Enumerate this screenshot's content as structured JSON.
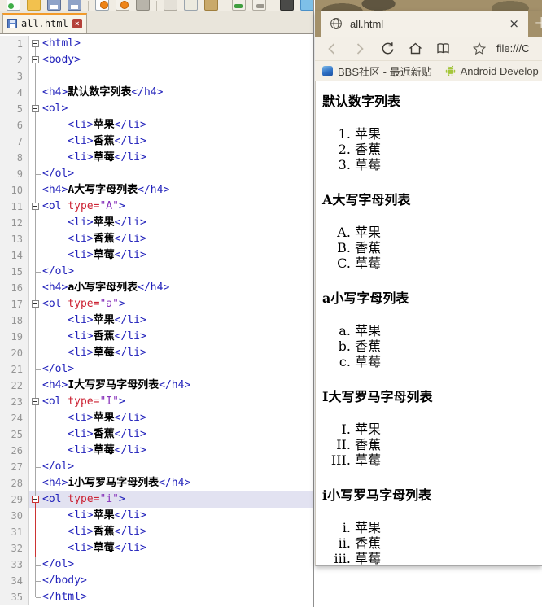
{
  "editor": {
    "toolbar_groups": [
      [
        "new-file-icon",
        "open-icon",
        "save-icon",
        "save-all-icon"
      ],
      [
        "print-preview-icon",
        "browser-refresh-icon",
        "print-icon"
      ],
      [
        "cut-icon",
        "copy-icon",
        "paste-icon"
      ],
      [
        "undo-icon",
        "redo-icon"
      ],
      [
        "find-icon",
        "browser-view-icon"
      ],
      [
        "settings-icon"
      ]
    ],
    "tab": {
      "title": "all.html",
      "close_glyph": "×"
    },
    "lines": [
      {
        "m": "box1",
        "c": [
          [
            "t",
            "<html>"
          ]
        ]
      },
      {
        "m": "box",
        "c": [
          [
            "t",
            "<body>"
          ]
        ]
      },
      {
        "m": "v",
        "c": []
      },
      {
        "m": "v",
        "c": [
          [
            "t",
            "<h4>"
          ],
          [
            "k",
            "默认数字列表"
          ],
          [
            "t",
            "</h4>"
          ]
        ]
      },
      {
        "m": "box",
        "c": [
          [
            "t",
            "<ol>"
          ]
        ]
      },
      {
        "m": "v",
        "c": [
          [
            "t",
            "    <li>"
          ],
          [
            "k",
            "苹果"
          ],
          [
            "t",
            "</li>"
          ]
        ]
      },
      {
        "m": "v",
        "c": [
          [
            "t",
            "    <li>"
          ],
          [
            "k",
            "香蕉"
          ],
          [
            "t",
            "</li>"
          ]
        ]
      },
      {
        "m": "v",
        "c": [
          [
            "t",
            "    <li>"
          ],
          [
            "k",
            "草莓"
          ],
          [
            "t",
            "</li>"
          ]
        ]
      },
      {
        "m": "tick",
        "c": [
          [
            "t",
            "</ol>"
          ]
        ]
      },
      {
        "m": "v",
        "c": [
          [
            "t",
            "<h4>"
          ],
          [
            "k",
            "A大写字母列表"
          ],
          [
            "t",
            "</h4>"
          ]
        ]
      },
      {
        "m": "box",
        "c": [
          [
            "t",
            "<ol "
          ],
          [
            "a",
            "type="
          ],
          [
            "v",
            "\"A\""
          ],
          [
            "t",
            ">"
          ]
        ]
      },
      {
        "m": "v",
        "c": [
          [
            "t",
            "    <li>"
          ],
          [
            "k",
            "苹果"
          ],
          [
            "t",
            "</li>"
          ]
        ]
      },
      {
        "m": "v",
        "c": [
          [
            "t",
            "    <li>"
          ],
          [
            "k",
            "香蕉"
          ],
          [
            "t",
            "</li>"
          ]
        ]
      },
      {
        "m": "v",
        "c": [
          [
            "t",
            "    <li>"
          ],
          [
            "k",
            "草莓"
          ],
          [
            "t",
            "</li>"
          ]
        ]
      },
      {
        "m": "tick",
        "c": [
          [
            "t",
            "</ol>"
          ]
        ]
      },
      {
        "m": "v",
        "c": [
          [
            "t",
            "<h4>"
          ],
          [
            "k",
            "a小写字母列表"
          ],
          [
            "t",
            "</h4>"
          ]
        ]
      },
      {
        "m": "box",
        "c": [
          [
            "t",
            "<ol "
          ],
          [
            "a",
            "type="
          ],
          [
            "v",
            "\"a\""
          ],
          [
            "t",
            ">"
          ]
        ]
      },
      {
        "m": "v",
        "c": [
          [
            "t",
            "    <li>"
          ],
          [
            "k",
            "苹果"
          ],
          [
            "t",
            "</li>"
          ]
        ]
      },
      {
        "m": "v",
        "c": [
          [
            "t",
            "    <li>"
          ],
          [
            "k",
            "香蕉"
          ],
          [
            "t",
            "</li>"
          ]
        ]
      },
      {
        "m": "v",
        "c": [
          [
            "t",
            "    <li>"
          ],
          [
            "k",
            "草莓"
          ],
          [
            "t",
            "</li>"
          ]
        ]
      },
      {
        "m": "tick",
        "c": [
          [
            "t",
            "</ol>"
          ]
        ]
      },
      {
        "m": "v",
        "c": [
          [
            "t",
            "<h4>"
          ],
          [
            "k",
            "I大写罗马字母列表"
          ],
          [
            "t",
            "</h4>"
          ]
        ]
      },
      {
        "m": "box",
        "c": [
          [
            "t",
            "<ol "
          ],
          [
            "a",
            "type="
          ],
          [
            "v",
            "\"I\""
          ],
          [
            "t",
            ">"
          ]
        ]
      },
      {
        "m": "v",
        "c": [
          [
            "t",
            "    <li>"
          ],
          [
            "k",
            "苹果"
          ],
          [
            "t",
            "</li>"
          ]
        ]
      },
      {
        "m": "v",
        "c": [
          [
            "t",
            "    <li>"
          ],
          [
            "k",
            "香蕉"
          ],
          [
            "t",
            "</li>"
          ]
        ]
      },
      {
        "m": "v",
        "c": [
          [
            "t",
            "    <li>"
          ],
          [
            "k",
            "草莓"
          ],
          [
            "t",
            "</li>"
          ]
        ]
      },
      {
        "m": "tick",
        "c": [
          [
            "t",
            "</ol>"
          ]
        ]
      },
      {
        "m": "v",
        "c": [
          [
            "t",
            "<h4>"
          ],
          [
            "k",
            "i小写罗马字母列表"
          ],
          [
            "t",
            "</h4>"
          ]
        ]
      },
      {
        "m": "boxr",
        "hl": true,
        "c": [
          [
            "t",
            "<ol "
          ],
          [
            "a",
            "type="
          ],
          [
            "v",
            "\"i\""
          ],
          [
            "t",
            ">"
          ]
        ]
      },
      {
        "m": "vr",
        "c": [
          [
            "t",
            "    <li>"
          ],
          [
            "k",
            "苹果"
          ],
          [
            "t",
            "</li>"
          ]
        ]
      },
      {
        "m": "vr",
        "c": [
          [
            "t",
            "    <li>"
          ],
          [
            "k",
            "香蕉"
          ],
          [
            "t",
            "</li>"
          ]
        ]
      },
      {
        "m": "vr",
        "c": [
          [
            "t",
            "    <li>"
          ],
          [
            "k",
            "草莓"
          ],
          [
            "t",
            "</li>"
          ]
        ]
      },
      {
        "m": "tick",
        "c": [
          [
            "t",
            "</ol>"
          ]
        ]
      },
      {
        "m": "tick",
        "c": [
          [
            "t",
            "</body>"
          ]
        ]
      },
      {
        "m": "tickend",
        "c": [
          [
            "t",
            "</html>"
          ]
        ]
      }
    ]
  },
  "browser": {
    "tab": {
      "title": "all.html",
      "close_glyph": "×"
    },
    "newtab_glyph": "+",
    "url": "file:///C",
    "bookmarks": [
      {
        "icon": "bbs-icon",
        "label": "BBS社区 - 最近新贴"
      },
      {
        "icon": "android-icon",
        "label": "Android Develop"
      }
    ],
    "sections": [
      {
        "heading": "默认数字列表",
        "type": "1",
        "items": [
          "苹果",
          "香蕉",
          "草莓"
        ]
      },
      {
        "heading": "A大写字母列表",
        "type": "A",
        "items": [
          "苹果",
          "香蕉",
          "草莓"
        ]
      },
      {
        "heading": "a小写字母列表",
        "type": "a",
        "items": [
          "苹果",
          "香蕉",
          "草莓"
        ]
      },
      {
        "heading": "I大写罗马字母列表",
        "type": "I",
        "items": [
          "苹果",
          "香蕉",
          "草莓"
        ]
      },
      {
        "heading": "i小写罗马字母列表",
        "type": "i",
        "items": [
          "苹果",
          "香蕉",
          "草莓"
        ]
      }
    ]
  },
  "colors": {
    "accent_orange": "#f29a29",
    "tag_blue": "#2222bb",
    "attr_red": "#cc2233",
    "value_purple": "#8833bb",
    "line_highlight": "#e2e2f1",
    "chrome_beige": "#f3efe7",
    "close_red": "#b5413a"
  }
}
